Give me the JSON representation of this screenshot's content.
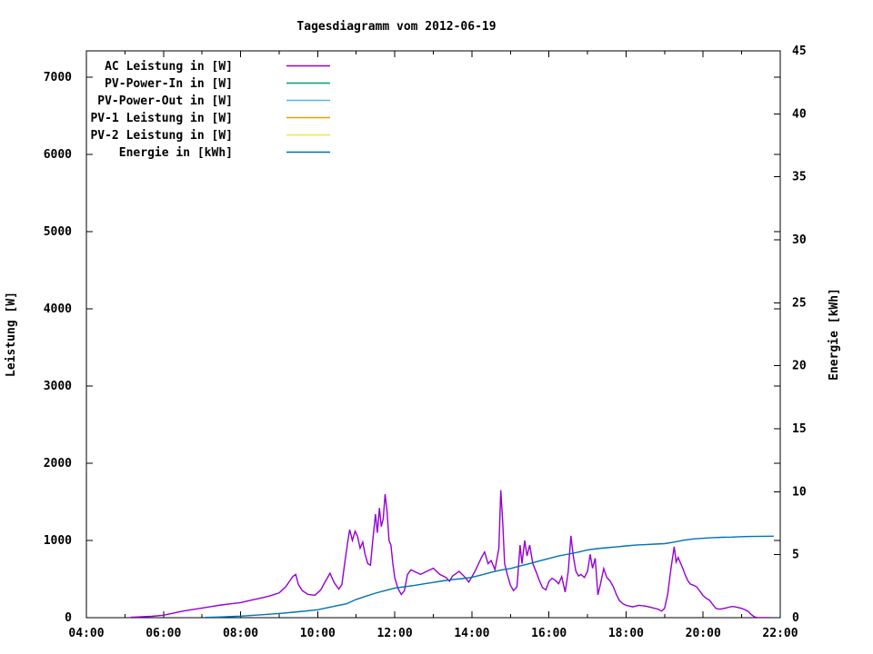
{
  "title": "Tagesdiagramm vom 2012-06-19",
  "chart_data": {
    "type": "line",
    "title": "Tagesdiagramm vom 2012-06-19",
    "grid": false,
    "background": "#ffffff",
    "border_color": "#000000",
    "x_axis": {
      "unit": "time of day",
      "range_hours": [
        4,
        22
      ],
      "major_ticks": [
        {
          "h": 4,
          "label": "04:00"
        },
        {
          "h": 6,
          "label": "06:00"
        },
        {
          "h": 8,
          "label": "08:00"
        },
        {
          "h": 10,
          "label": "10:00"
        },
        {
          "h": 12,
          "label": "12:00"
        },
        {
          "h": 14,
          "label": "14:00"
        },
        {
          "h": 16,
          "label": "16:00"
        },
        {
          "h": 18,
          "label": "18:00"
        },
        {
          "h": 20,
          "label": "20:00"
        },
        {
          "h": 22,
          "label": "22:00"
        }
      ],
      "minor_tick_every_hours": 1
    },
    "y_left": {
      "label": "Leistung [W]",
      "range": [
        0,
        7340
      ],
      "ticks": [
        {
          "v": 0,
          "label": "0"
        },
        {
          "v": 1000,
          "label": "1000"
        },
        {
          "v": 2000,
          "label": "2000"
        },
        {
          "v": 3000,
          "label": "3000"
        },
        {
          "v": 4000,
          "label": "4000"
        },
        {
          "v": 5000,
          "label": "5000"
        },
        {
          "v": 6000,
          "label": "6000"
        },
        {
          "v": 7000,
          "label": "7000"
        }
      ]
    },
    "y_right": {
      "label": "Energie [kWh]",
      "range": [
        0,
        45
      ],
      "ticks": [
        {
          "v": 0,
          "label": "0"
        },
        {
          "v": 5,
          "label": "5"
        },
        {
          "v": 10,
          "label": "10"
        },
        {
          "v": 15,
          "label": "15"
        },
        {
          "v": 20,
          "label": "20"
        },
        {
          "v": 25,
          "label": "25"
        },
        {
          "v": 30,
          "label": "30"
        },
        {
          "v": 35,
          "label": "35"
        },
        {
          "v": 40,
          "label": "40"
        },
        {
          "v": 45,
          "label": "45"
        }
      ],
      "mirror_left_ticks_on_right_border": true
    },
    "legend_position": "top-left-inside",
    "series": [
      {
        "name": "AC Leistung in [W]",
        "color": "#9400d3",
        "axis": "left",
        "points": [
          [
            5.15,
            5
          ],
          [
            5.4,
            10
          ],
          [
            5.7,
            18
          ],
          [
            6.0,
            32
          ],
          [
            6.25,
            58
          ],
          [
            6.5,
            85
          ],
          [
            6.75,
            105
          ],
          [
            7.0,
            125
          ],
          [
            7.25,
            145
          ],
          [
            7.5,
            165
          ],
          [
            7.75,
            180
          ],
          [
            8.0,
            195
          ],
          [
            8.25,
            225
          ],
          [
            8.5,
            250
          ],
          [
            8.75,
            280
          ],
          [
            9.0,
            320
          ],
          [
            9.17,
            400
          ],
          [
            9.35,
            530
          ],
          [
            9.43,
            560
          ],
          [
            9.5,
            430
          ],
          [
            9.6,
            350
          ],
          [
            9.75,
            300
          ],
          [
            9.93,
            290
          ],
          [
            10.08,
            360
          ],
          [
            10.2,
            470
          ],
          [
            10.32,
            575
          ],
          [
            10.43,
            450
          ],
          [
            10.55,
            370
          ],
          [
            10.63,
            430
          ],
          [
            10.7,
            700
          ],
          [
            10.77,
            950
          ],
          [
            10.83,
            1140
          ],
          [
            10.9,
            1000
          ],
          [
            10.97,
            1120
          ],
          [
            11.03,
            1060
          ],
          [
            11.1,
            900
          ],
          [
            11.17,
            980
          ],
          [
            11.23,
            820
          ],
          [
            11.3,
            700
          ],
          [
            11.37,
            680
          ],
          [
            11.43,
            1000
          ],
          [
            11.5,
            1340
          ],
          [
            11.55,
            1100
          ],
          [
            11.6,
            1420
          ],
          [
            11.65,
            1180
          ],
          [
            11.7,
            1280
          ],
          [
            11.75,
            1600
          ],
          [
            11.8,
            1380
          ],
          [
            11.85,
            1000
          ],
          [
            11.9,
            940
          ],
          [
            11.95,
            700
          ],
          [
            12.0,
            520
          ],
          [
            12.08,
            380
          ],
          [
            12.17,
            300
          ],
          [
            12.25,
            350
          ],
          [
            12.33,
            560
          ],
          [
            12.42,
            620
          ],
          [
            12.5,
            600
          ],
          [
            12.67,
            560
          ],
          [
            12.83,
            600
          ],
          [
            13.0,
            640
          ],
          [
            13.17,
            560
          ],
          [
            13.33,
            520
          ],
          [
            13.42,
            470
          ],
          [
            13.5,
            540
          ],
          [
            13.67,
            600
          ],
          [
            13.83,
            520
          ],
          [
            13.92,
            460
          ],
          [
            14.08,
            600
          ],
          [
            14.25,
            780
          ],
          [
            14.33,
            850
          ],
          [
            14.42,
            700
          ],
          [
            14.5,
            740
          ],
          [
            14.6,
            620
          ],
          [
            14.7,
            900
          ],
          [
            14.75,
            1650
          ],
          [
            14.8,
            1240
          ],
          [
            14.85,
            700
          ],
          [
            14.92,
            560
          ],
          [
            15.0,
            420
          ],
          [
            15.08,
            350
          ],
          [
            15.17,
            400
          ],
          [
            15.25,
            940
          ],
          [
            15.3,
            700
          ],
          [
            15.37,
            1000
          ],
          [
            15.43,
            800
          ],
          [
            15.5,
            940
          ],
          [
            15.58,
            700
          ],
          [
            15.67,
            590
          ],
          [
            15.75,
            480
          ],
          [
            15.83,
            390
          ],
          [
            15.92,
            360
          ],
          [
            16.0,
            470
          ],
          [
            16.08,
            510
          ],
          [
            16.17,
            480
          ],
          [
            16.25,
            440
          ],
          [
            16.33,
            530
          ],
          [
            16.42,
            330
          ],
          [
            16.5,
            600
          ],
          [
            16.57,
            1060
          ],
          [
            16.63,
            800
          ],
          [
            16.7,
            600
          ],
          [
            16.77,
            540
          ],
          [
            16.83,
            560
          ],
          [
            16.92,
            520
          ],
          [
            17.0,
            600
          ],
          [
            17.07,
            820
          ],
          [
            17.13,
            640
          ],
          [
            17.2,
            770
          ],
          [
            17.27,
            295
          ],
          [
            17.33,
            420
          ],
          [
            17.42,
            635
          ],
          [
            17.5,
            520
          ],
          [
            17.58,
            480
          ],
          [
            17.67,
            400
          ],
          [
            17.75,
            300
          ],
          [
            17.83,
            220
          ],
          [
            17.92,
            180
          ],
          [
            18.0,
            160
          ],
          [
            18.17,
            140
          ],
          [
            18.33,
            160
          ],
          [
            18.5,
            150
          ],
          [
            18.67,
            130
          ],
          [
            18.83,
            110
          ],
          [
            18.92,
            85
          ],
          [
            19.0,
            120
          ],
          [
            19.08,
            300
          ],
          [
            19.17,
            650
          ],
          [
            19.25,
            920
          ],
          [
            19.3,
            720
          ],
          [
            19.35,
            780
          ],
          [
            19.42,
            700
          ],
          [
            19.47,
            640
          ],
          [
            19.53,
            560
          ],
          [
            19.6,
            480
          ],
          [
            19.67,
            435
          ],
          [
            19.75,
            420
          ],
          [
            19.83,
            400
          ],
          [
            19.92,
            340
          ],
          [
            20.0,
            285
          ],
          [
            20.08,
            250
          ],
          [
            20.17,
            225
          ],
          [
            20.25,
            170
          ],
          [
            20.33,
            120
          ],
          [
            20.42,
            110
          ],
          [
            20.5,
            115
          ],
          [
            20.58,
            125
          ],
          [
            20.67,
            135
          ],
          [
            20.75,
            145
          ],
          [
            20.83,
            140
          ],
          [
            20.92,
            130
          ],
          [
            21.0,
            120
          ],
          [
            21.08,
            105
          ],
          [
            21.17,
            80
          ],
          [
            21.25,
            40
          ],
          [
            21.33,
            10
          ],
          [
            21.42,
            0
          ],
          [
            21.6,
            0
          ],
          [
            21.75,
            0
          ]
        ]
      },
      {
        "name": "PV-Power-In in [W]",
        "color": "#009e73",
        "axis": "left",
        "points": []
      },
      {
        "name": "PV-Power-Out in [W]",
        "color": "#56b4e9",
        "axis": "left",
        "points": []
      },
      {
        "name": "PV-1 Leistung in [W]",
        "color": "#e69f00",
        "axis": "left",
        "points": []
      },
      {
        "name": "PV-2 Leistung in [W]",
        "color": "#f0e442",
        "axis": "left",
        "points": []
      },
      {
        "name": "Energie in [kWh]",
        "color": "#0072b2",
        "axis": "right",
        "points": [
          [
            7.08,
            0.02
          ],
          [
            7.5,
            0.06
          ],
          [
            8.0,
            0.12
          ],
          [
            8.5,
            0.22
          ],
          [
            9.0,
            0.33
          ],
          [
            9.5,
            0.47
          ],
          [
            10.0,
            0.63
          ],
          [
            10.5,
            0.95
          ],
          [
            10.75,
            1.1
          ],
          [
            11.0,
            1.45
          ],
          [
            11.25,
            1.7
          ],
          [
            11.5,
            1.95
          ],
          [
            11.75,
            2.15
          ],
          [
            12.0,
            2.35
          ],
          [
            12.25,
            2.45
          ],
          [
            12.5,
            2.55
          ],
          [
            12.75,
            2.68
          ],
          [
            13.0,
            2.8
          ],
          [
            13.25,
            2.92
          ],
          [
            13.5,
            3.02
          ],
          [
            13.75,
            3.1
          ],
          [
            14.0,
            3.2
          ],
          [
            14.25,
            3.4
          ],
          [
            14.5,
            3.6
          ],
          [
            14.75,
            3.78
          ],
          [
            15.0,
            3.9
          ],
          [
            15.25,
            4.1
          ],
          [
            15.5,
            4.3
          ],
          [
            15.75,
            4.5
          ],
          [
            16.0,
            4.7
          ],
          [
            16.25,
            4.9
          ],
          [
            16.5,
            5.05
          ],
          [
            16.75,
            5.2
          ],
          [
            17.0,
            5.38
          ],
          [
            17.25,
            5.48
          ],
          [
            17.5,
            5.55
          ],
          [
            17.75,
            5.62
          ],
          [
            18.0,
            5.7
          ],
          [
            18.25,
            5.76
          ],
          [
            18.5,
            5.8
          ],
          [
            18.75,
            5.84
          ],
          [
            19.0,
            5.88
          ],
          [
            19.25,
            6.0
          ],
          [
            19.5,
            6.15
          ],
          [
            19.75,
            6.25
          ],
          [
            20.0,
            6.3
          ],
          [
            20.25,
            6.35
          ],
          [
            20.5,
            6.38
          ],
          [
            20.75,
            6.4
          ],
          [
            21.0,
            6.43
          ],
          [
            21.25,
            6.45
          ],
          [
            21.5,
            6.46
          ],
          [
            21.83,
            6.47
          ]
        ]
      }
    ]
  }
}
